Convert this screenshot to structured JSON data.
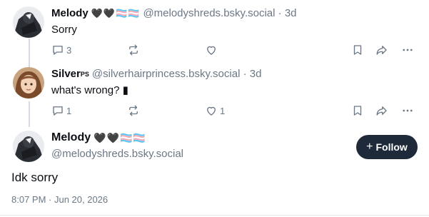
{
  "posts": [
    {
      "author": "Melody",
      "emoji": "🖤🖤🏳️‍⚧️🏳️‍⚧️",
      "handle": "@melodyshreds.bsky.social",
      "time": "3d",
      "text": "Sorry",
      "replies": "3",
      "reposts": "",
      "likes": ""
    },
    {
      "author": "Silver",
      "author_suffix": "PS",
      "handle": "@silverhairprincess.bsky.social",
      "time": "3d",
      "text": "what's wrong? ▮",
      "replies": "1",
      "reposts": "",
      "likes": "1"
    }
  ],
  "main_post": {
    "author": "Melody",
    "emoji": "🖤🖤🏳️‍⚧️🏳️‍⚧️",
    "handle": "@melodyshreds.bsky.social",
    "follow_label": "Follow",
    "text": "Idk sorry",
    "timestamp": "8:07 PM · Jun 20, 2026"
  },
  "colors": {
    "accent_button": "#1e2a3a",
    "muted_text": "#6b7886",
    "thread_line": "#d4dbe2"
  },
  "icons": [
    "reply-icon",
    "repost-icon",
    "like-icon",
    "bookmark-icon",
    "share-icon",
    "more-icon",
    "plus-icon"
  ]
}
